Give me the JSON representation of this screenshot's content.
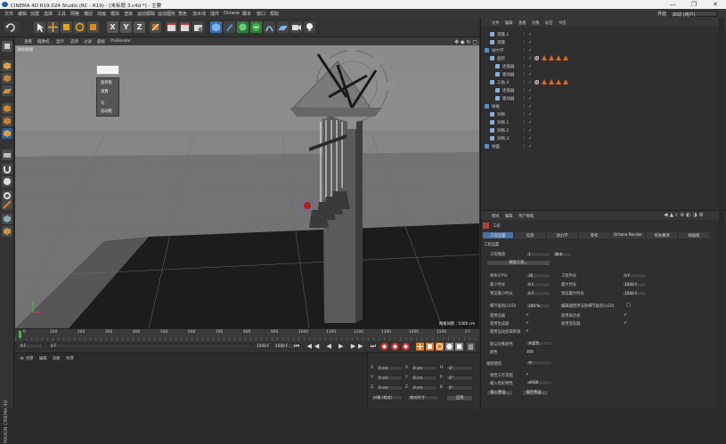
{
  "window": {
    "title": "CINEMA 4D R19.024 Studio (RC - R19) - [未标题 3.c4d *] - 主要",
    "minimize": "—",
    "maximize": "❐",
    "close": "✕"
  },
  "menu": {
    "items": [
      "文件",
      "编辑",
      "创建",
      "选择",
      "工具",
      "网格",
      "捕捉",
      "动画",
      "模拟",
      "渲染",
      "运动跟踪",
      "运动图形",
      "角色",
      "流水线",
      "插件",
      "Octane",
      "脚本",
      "窗口",
      "帮助"
    ],
    "layout_label": "界面",
    "layout_value": "启动 (用户)"
  },
  "toolbar": {
    "axis_x": "X",
    "axis_y": "Y",
    "axis_z": "Z"
  },
  "viewport": {
    "menu": [
      "查看",
      "摄像机",
      "显示",
      "选项",
      "过滤",
      "面板",
      "ProRender"
    ],
    "view_label": "透视视图",
    "grid_info": "网格间距 : 1000 cm",
    "popup_items": [
      "旋转框",
      "演算",
      "匀",
      "运动框"
    ]
  },
  "timeline": {
    "ticks": [
      "0",
      "100",
      "200",
      "300",
      "400",
      "500",
      "600",
      "700",
      "800",
      "900",
      "1000",
      "1100",
      "1200",
      "1300",
      "1400",
      "1500"
    ],
    "frame_right": "0 F"
  },
  "transport": {
    "start_frame": "0 F",
    "current_frame": "0 F",
    "end_frame": "1500 F",
    "end_frame2": "1500 F"
  },
  "material": {
    "menu": [
      "创建",
      "编辑",
      "功能",
      "纹理"
    ]
  },
  "coords": {
    "rows": [
      {
        "axis": "X",
        "pos": "0 cm",
        "axis2": "X",
        "size": "0 cm",
        "axis3": "H",
        "rot": "0°"
      },
      {
        "axis": "Y",
        "pos": "0 cm",
        "axis2": "Y",
        "size": "0 cm",
        "axis3": "P",
        "rot": "0°"
      },
      {
        "axis": "Z",
        "pos": "0 cm",
        "axis2": "Z",
        "size": "0 cm",
        "axis3": "B",
        "rot": "0°"
      }
    ],
    "mode": "对象 (相对)",
    "mode2": "绝对尺寸",
    "apply": "应用"
  },
  "objects": {
    "menu": [
      "文件",
      "编辑",
      "查看",
      "对象",
      "标签",
      "书签"
    ],
    "rows": [
      {
        "name": "克隆.1",
        "indent": 1,
        "tags": 0
      },
      {
        "name": "克隆",
        "indent": 1,
        "tags": 0
      },
      {
        "name": "动力学",
        "indent": 0,
        "tags": 0
      },
      {
        "name": "齿轮",
        "indent": 1,
        "tags": 4
      },
      {
        "name": "连接器",
        "indent": 2,
        "tags": 0
      },
      {
        "name": "驱动器",
        "indent": 2,
        "tags": 0
      },
      {
        "name": "三角 4",
        "indent": 1,
        "tags": 4
      },
      {
        "name": "连接器",
        "indent": 2,
        "tags": 0
      },
      {
        "name": "驱动器",
        "indent": 2,
        "tags": 0
      },
      {
        "name": "样板",
        "indent": 0,
        "tags": 0
      },
      {
        "name": "对称",
        "indent": 1,
        "tags": 0
      },
      {
        "name": "对称.1",
        "indent": 1,
        "tags": 0
      },
      {
        "name": "对称.2",
        "indent": 1,
        "tags": 0
      },
      {
        "name": "对称.3",
        "indent": 1,
        "tags": 0
      },
      {
        "name": "地面",
        "indent": 0,
        "tags": 0
      }
    ]
  },
  "attributes": {
    "menu": [
      "模式",
      "编辑",
      "用户数据"
    ],
    "section": "工程",
    "tabs": [
      "工程设置",
      "信息",
      "动力学",
      "参考",
      "Octane Render",
      "待办事项",
      "帧插值"
    ],
    "heading": "工程设置",
    "scale_label": "工程缩放",
    "scale_value": "1",
    "scale_unit": "厘米",
    "scale_button": "缩放工程...",
    "fields_left": [
      {
        "label": "帧率(FPS)",
        "value": "30"
      },
      {
        "label": "最小时长",
        "value": "0 F"
      },
      {
        "label": "预览最小时长",
        "value": "0 F"
      }
    ],
    "fields_right": [
      {
        "label": "工程时长",
        "value": "0 F"
      },
      {
        "label": "最大时长",
        "value": "1500 F"
      },
      {
        "label": "预览最大时长",
        "value": "1500 F"
      }
    ],
    "lod_label": "细节级别(LOD)",
    "lod_value": "100 %",
    "lod_render": "编辑器使用渲染细节级别(LOD)",
    "checks_left": [
      "使用动画",
      "使用生成器",
      "使用运动剪辑系统"
    ],
    "checks_right": [
      "使用表达式",
      "使用变形器"
    ],
    "default_color_label": "默认对象颜色",
    "default_color_value": "灰蓝色",
    "color_label": "颜色",
    "view_clip_label": "视图修剪",
    "view_clip_value": "中",
    "linear_label": "线性工作流程",
    "input_color_label": "输入色彩特性",
    "input_color_value": "sRGB",
    "load_preset": "载入预设...",
    "save_preset": "保存预设..."
  }
}
